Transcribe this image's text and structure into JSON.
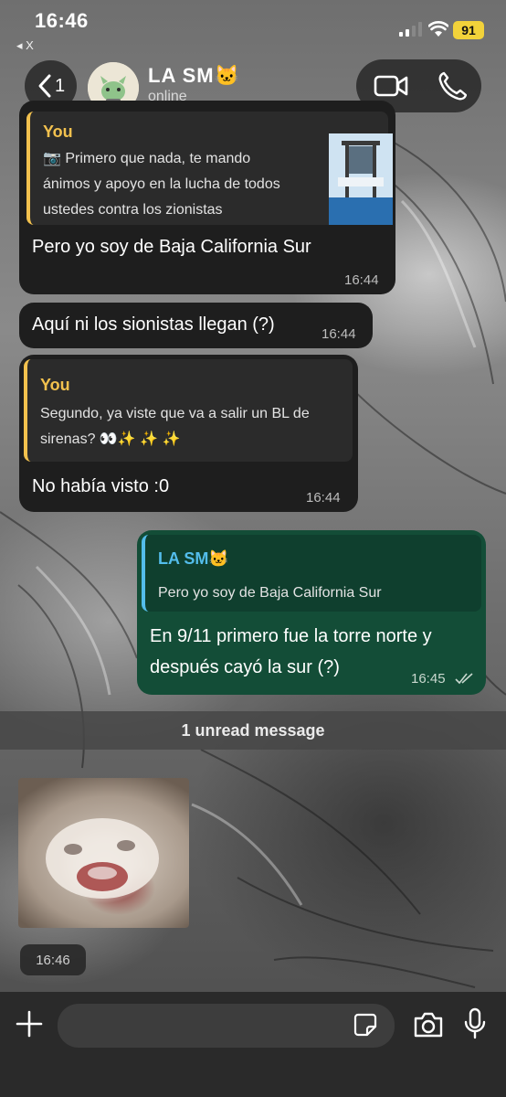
{
  "status_bar": {
    "time": "16:46",
    "back_to_app": "◂ X",
    "battery": "91"
  },
  "header": {
    "back_count": "1",
    "contact_name": "LA SM🐱",
    "contact_status": "online"
  },
  "messages": [
    {
      "direction": "in",
      "quote_author": "You",
      "quote_text_1": "📷 Primero que nada, te mando",
      "quote_text_2": "ánimos y apoyo en la lucha de todos",
      "quote_text_3": "ustedes contra los zionistas",
      "text": "Pero yo soy de Baja California Sur",
      "time": "16:44"
    },
    {
      "direction": "in",
      "text": "Aquí ni los sionistas llegan (?)",
      "time": "16:44"
    },
    {
      "direction": "in",
      "quote_author": "You",
      "quote_text_1": "Segundo, ya viste que va a salir un BL de",
      "quote_text_2": "sirenas? 👀✨ ✨ ✨",
      "text": "No había visto :0",
      "time": "16:44"
    },
    {
      "direction": "out",
      "quote_author": "LA SM🐱",
      "quote_text_1": "Pero yo soy de Baja California Sur",
      "text_1": "En 9/11 primero fue la torre norte y",
      "text_2": "después cayó la sur (?)",
      "time": "16:45"
    }
  ],
  "unread_label": "1 unread message",
  "image_message": {
    "time": "16:46"
  },
  "composer": {
    "placeholder": ""
  },
  "colors": {
    "incoming_bubble": "#1e1e1e",
    "outgoing_bubble": "#134d37",
    "quote_accent_yellow": "#f2c14e",
    "quote_accent_blue": "#53bdeb",
    "battery": "#f2d23a"
  }
}
